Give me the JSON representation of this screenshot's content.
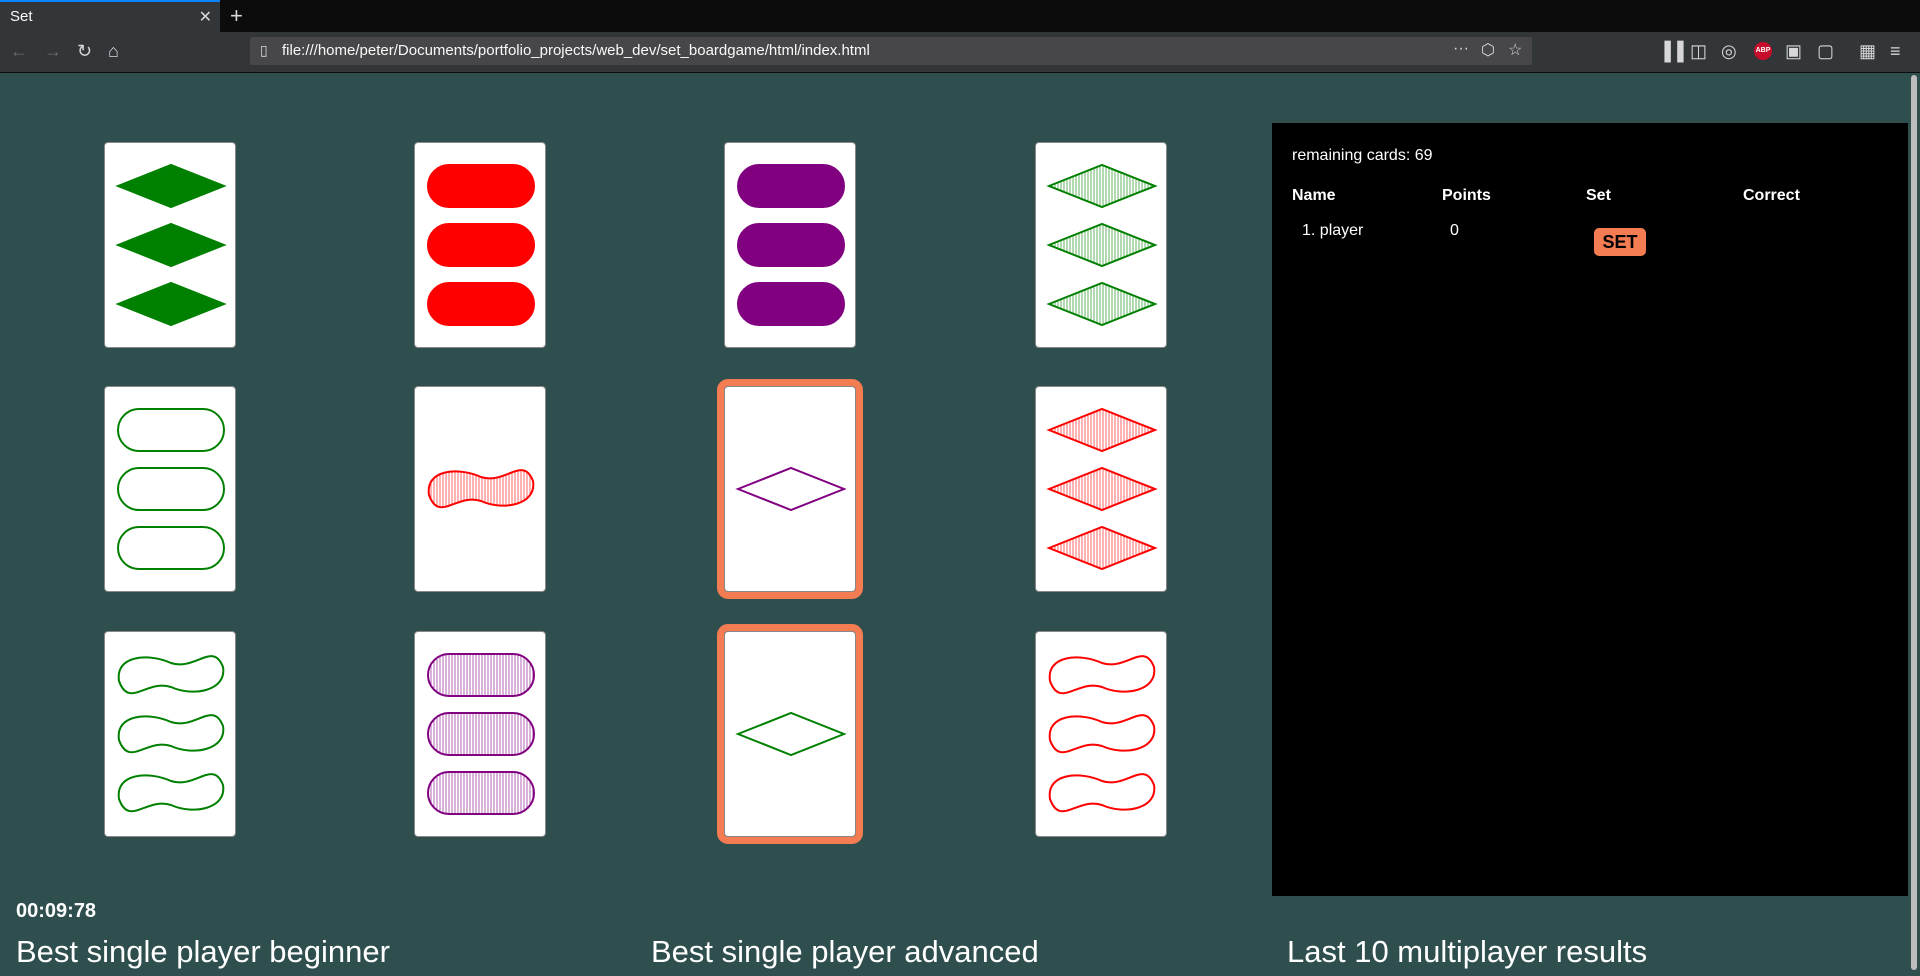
{
  "browser": {
    "tab_title": "Set",
    "tab_close": "✕",
    "new_tab": "+",
    "url": "file:///home/peter/Documents/portfolio_projects/web_dev/set_boardgame/html/index.html",
    "page_actions": "···",
    "addon_badge": "ABP"
  },
  "game": {
    "remaining_label": "remaining cards: 69",
    "table": {
      "headers": [
        "Name",
        "Points",
        "Set",
        "Correct"
      ],
      "rows": [
        {
          "name": "1. player",
          "points": "0",
          "set_button": "SET",
          "correct": ""
        }
      ]
    },
    "timer": "00:09:78",
    "sections": [
      "Best single player beginner",
      "Best single player advanced",
      "Last 10 multiplayer results"
    ],
    "colors": {
      "background": "#2f4f4f",
      "selection": "#f47c52",
      "green": "#008000",
      "red": "#ff0000",
      "purple": "#800080"
    },
    "cards": [
      {
        "shape": "diamond",
        "count": 3,
        "color": "#008000",
        "fill": "solid",
        "selected": false
      },
      {
        "shape": "oval",
        "count": 3,
        "color": "#ff0000",
        "fill": "solid",
        "selected": false
      },
      {
        "shape": "oval",
        "count": 3,
        "color": "#800080",
        "fill": "solid",
        "selected": false
      },
      {
        "shape": "diamond",
        "count": 3,
        "color": "#008000",
        "fill": "striped",
        "selected": false
      },
      {
        "shape": "oval",
        "count": 3,
        "color": "#008000",
        "fill": "empty",
        "selected": false
      },
      {
        "shape": "squiggle",
        "count": 1,
        "color": "#ff0000",
        "fill": "striped",
        "selected": false
      },
      {
        "shape": "diamond",
        "count": 1,
        "color": "#800080",
        "fill": "empty",
        "selected": true
      },
      {
        "shape": "diamond",
        "count": 3,
        "color": "#ff0000",
        "fill": "striped",
        "selected": false
      },
      {
        "shape": "squiggle",
        "count": 3,
        "color": "#008000",
        "fill": "empty",
        "selected": false
      },
      {
        "shape": "oval",
        "count": 3,
        "color": "#800080",
        "fill": "striped",
        "selected": false
      },
      {
        "shape": "diamond",
        "count": 1,
        "color": "#008000",
        "fill": "empty",
        "selected": true
      },
      {
        "shape": "squiggle",
        "count": 3,
        "color": "#ff0000",
        "fill": "empty",
        "selected": false
      }
    ]
  }
}
